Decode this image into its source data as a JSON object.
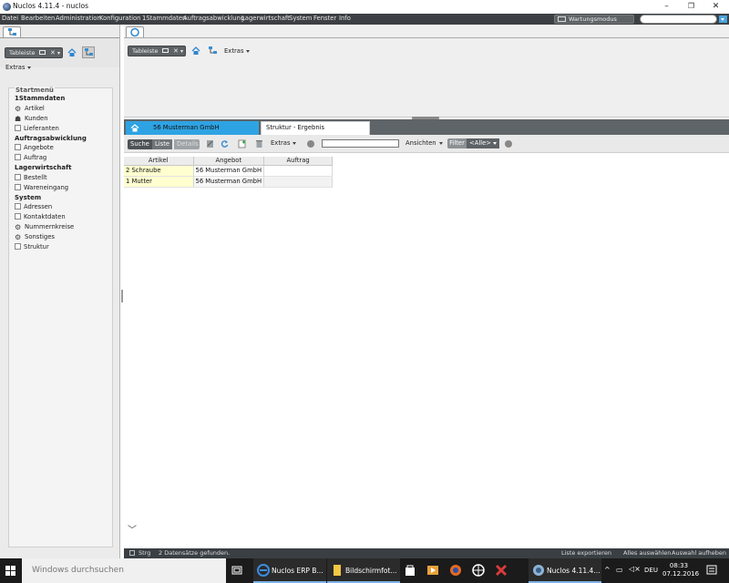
{
  "window": {
    "title": "Nuclos 4.11.4 - nuclos"
  },
  "menubar": {
    "items": [
      "Datei",
      "Bearbeiten",
      "Administration",
      "Konfiguration",
      "1Stammdaten",
      "Auftragsabwicklung",
      "Lagerwirtschaft",
      "System",
      "Fenster",
      "Info"
    ],
    "wartungsmodus": "Wartungsmodus"
  },
  "left_panel": {
    "tableiste": "Tableiste",
    "extras": "Extras",
    "startmenu": {
      "title": "Startmenü",
      "groups": [
        {
          "label": "1Stammdaten",
          "items": [
            {
              "label": "Artikel",
              "icon": "gears-icon"
            },
            {
              "label": "Kunden",
              "icon": "people-icon"
            },
            {
              "label": "Lieferanten",
              "icon": "checkbox-icon"
            }
          ]
        },
        {
          "label": "Auftragsabwicklung",
          "items": [
            {
              "label": "Angebote",
              "icon": "checkbox-icon"
            },
            {
              "label": "Auftrag",
              "icon": "checkbox-icon"
            }
          ]
        },
        {
          "label": "Lagerwirtschaft",
          "items": [
            {
              "label": "Bestellt",
              "icon": "checkbox-icon"
            },
            {
              "label": "Wareneingang",
              "icon": "checkbox-icon"
            }
          ]
        },
        {
          "label": "System",
          "items": [
            {
              "label": "Adressen",
              "icon": "checkbox-icon"
            },
            {
              "label": "Kontaktdaten",
              "icon": "checkbox-icon"
            },
            {
              "label": "Nummernkreise",
              "icon": "gear-icon"
            },
            {
              "label": "Sonstiges",
              "icon": "gears-icon"
            },
            {
              "label": "Struktur",
              "icon": "checkbox-icon"
            }
          ]
        }
      ]
    }
  },
  "right_panel": {
    "tableiste": "Tableiste",
    "extras": "Extras",
    "tabs": [
      {
        "label": "56  Musterman GmbH",
        "active": true
      },
      {
        "label": "Struktur - Ergebnis",
        "active": false
      }
    ],
    "toolbar": {
      "suche": "Suche",
      "liste": "Liste",
      "details": "Details",
      "extras": "Extras",
      "search_value": "",
      "ansichten": "Ansichten",
      "filter": "Filter",
      "filter_value": "<Alle>"
    },
    "table": {
      "columns": [
        "Artikel",
        "Angebot",
        "Auftrag"
      ],
      "rows": [
        [
          "2 Schraube",
          "56  Musterman GmbH",
          ""
        ],
        [
          "1 Mutter",
          "56  Musterman GmbH",
          ""
        ]
      ]
    },
    "status": {
      "strg": "Strg",
      "found": "2 Datensätze gefunden.",
      "export": "Liste exportieren",
      "select_all": "Alles auswählen",
      "deselect": "Auswahl aufheben"
    }
  },
  "taskbar": {
    "search_placeholder": "Windows durchsuchen",
    "tasks": [
      "Nuclos ERP B...",
      "Bildschirmfot...",
      "Nuclos 4.11.4..."
    ],
    "language": "DEU",
    "time": "08:33",
    "date": "07.12.2016"
  },
  "colors": {
    "accent": "#2ea3e3",
    "menubar": "#3c4044",
    "row_highlight": "#ffffd0"
  }
}
